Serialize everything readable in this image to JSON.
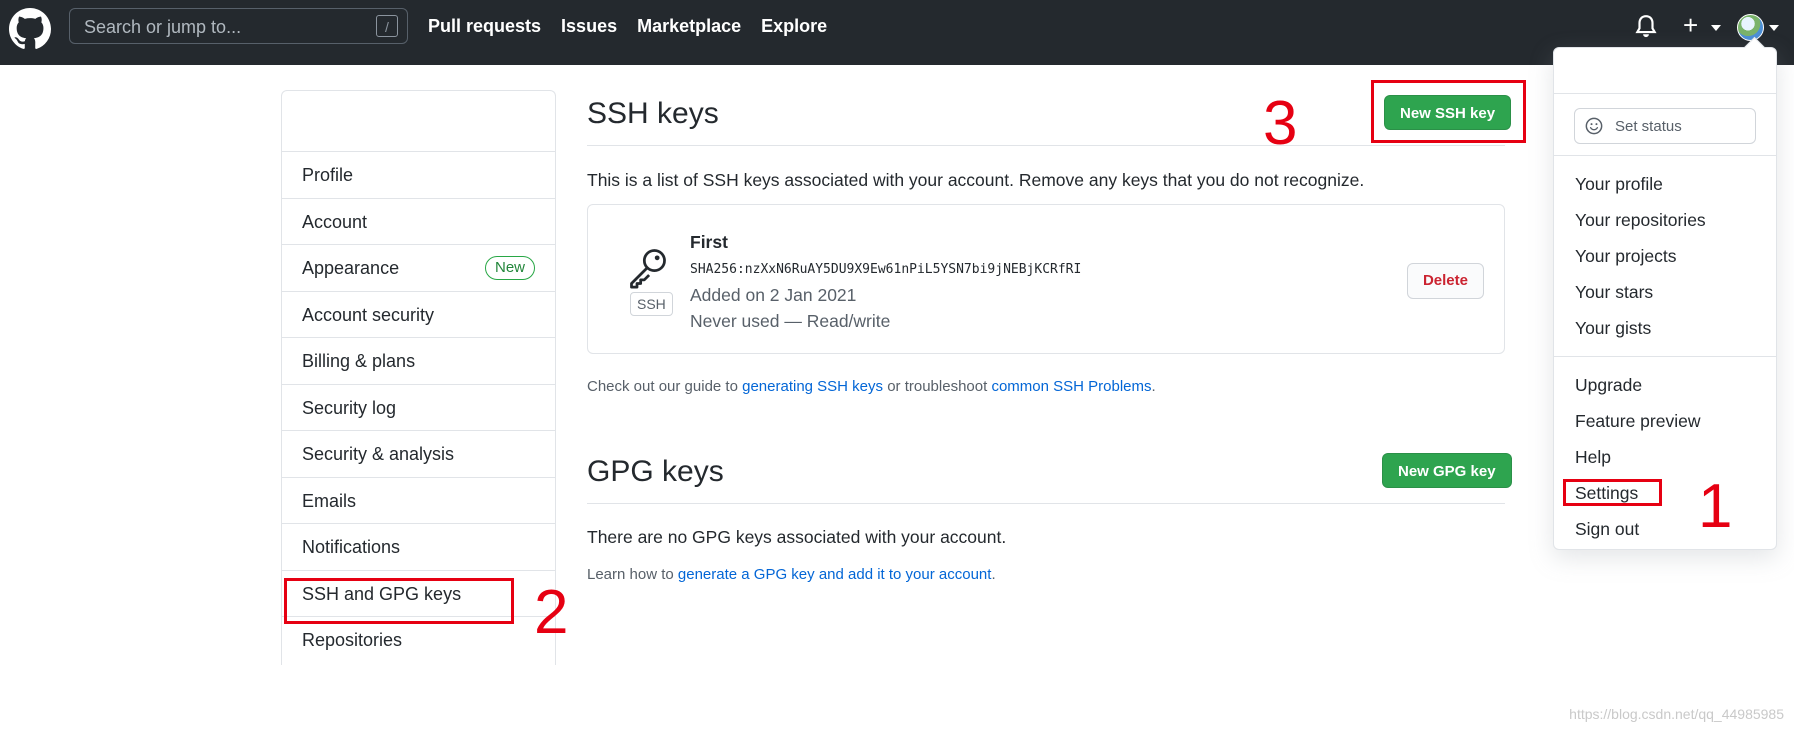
{
  "header": {
    "search_placeholder": "Search or jump to...",
    "search_shortcut": "/",
    "nav": [
      "Pull requests",
      "Issues",
      "Marketplace",
      "Explore"
    ],
    "plus_symbol": "+",
    "icons": [
      "github-logo-icon",
      "bell-icon",
      "plus-icon",
      "avatar"
    ]
  },
  "sidebar": {
    "items": [
      {
        "label": "Profile"
      },
      {
        "label": "Account"
      },
      {
        "label": "Appearance",
        "badge": "New"
      },
      {
        "label": "Account security"
      },
      {
        "label": "Billing & plans"
      },
      {
        "label": "Security log"
      },
      {
        "label": "Security & analysis"
      },
      {
        "label": "Emails"
      },
      {
        "label": "Notifications"
      },
      {
        "label": "SSH and GPG keys"
      },
      {
        "label": "Repositories"
      }
    ]
  },
  "ssh": {
    "title": "SSH keys",
    "new_button": "New SSH key",
    "description": "This is a list of SSH keys associated with your account. Remove any keys that you do not recognize.",
    "key": {
      "name": "First",
      "fingerprint": "SHA256:nzXxN6RuAY5DU9X9Ew61nPiL5YSN7bi9jNEBjKCRfRI",
      "added": "Added on 2 Jan 2021",
      "usage": "Never used — Read/write",
      "type_label": "SSH",
      "delete_button": "Delete"
    },
    "guide_prefix": "Check out our guide to ",
    "guide_link1": "generating SSH keys",
    "guide_middle": " or troubleshoot ",
    "guide_link2": "common SSH Problems",
    "guide_suffix": "."
  },
  "gpg": {
    "title": "GPG keys",
    "new_button": "New GPG key",
    "empty_text": "There are no GPG keys associated with your account.",
    "learn_prefix": "Learn how to ",
    "learn_link": "generate a GPG key and add it to your account",
    "learn_suffix": "."
  },
  "dropdown": {
    "set_status": "Set status",
    "group1": [
      "Your profile",
      "Your repositories",
      "Your projects",
      "Your stars",
      "Your gists"
    ],
    "group2": [
      "Upgrade",
      "Feature preview",
      "Help",
      "Settings",
      "Sign out"
    ]
  },
  "annotations": {
    "step1": "1",
    "step2": "2",
    "step3": "3",
    "color": "#e60012"
  },
  "watermark": "https://blog.csdn.net/qq_44985985",
  "colors": {
    "header": "#24292e",
    "green": "#2ea44f",
    "link": "#0366d6",
    "danger": "#cb2431"
  }
}
